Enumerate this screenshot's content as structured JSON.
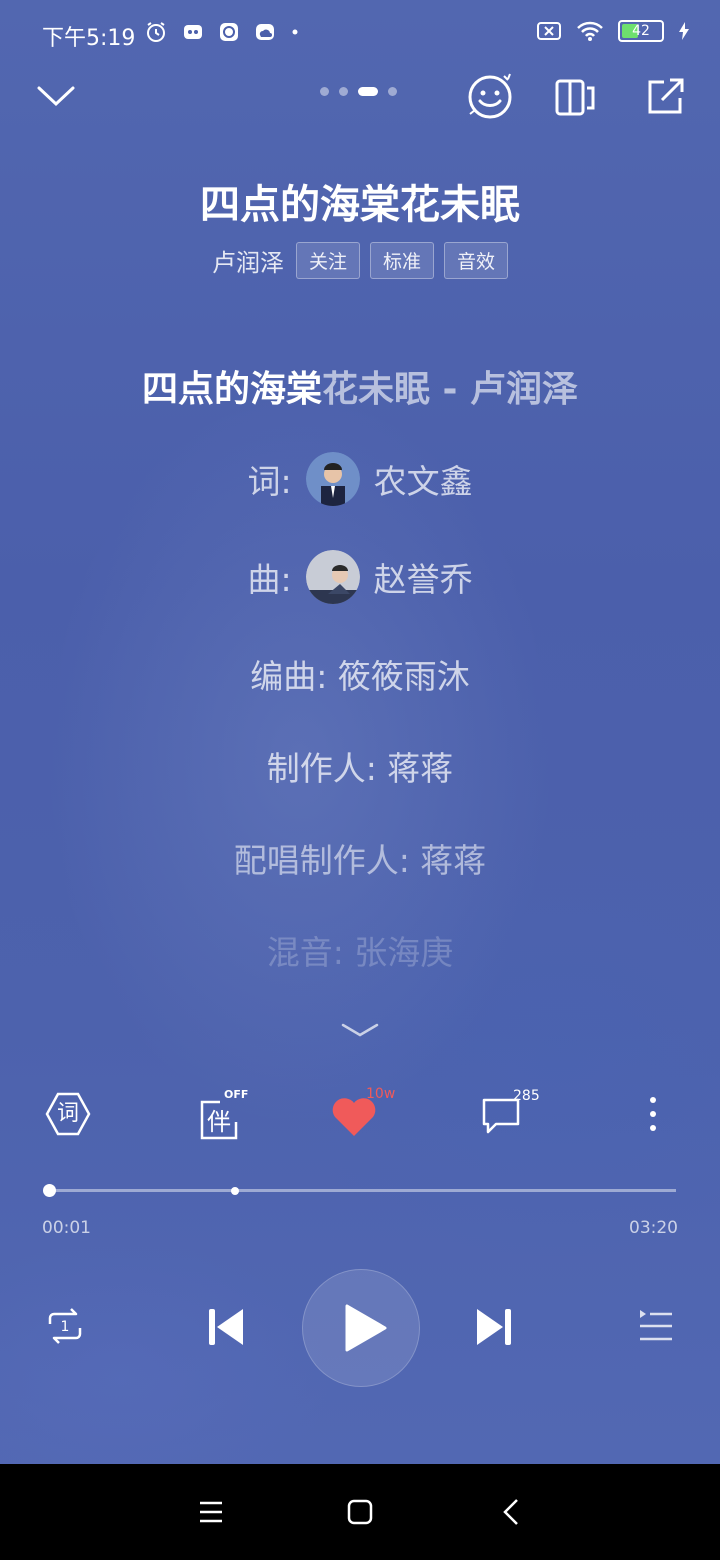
{
  "status_bar": {
    "time": "下午5:19",
    "battery_level": "42",
    "icons_left": [
      "alarm-icon",
      "app-notification-icon",
      "compass-notification-icon",
      "weather-notification-icon",
      "dot-icon"
    ],
    "icons_right": [
      "sim-off-icon",
      "wifi-icon",
      "battery-icon",
      "charging-icon"
    ]
  },
  "top_bar": {
    "page_count": 4,
    "active_page_index": 2
  },
  "song": {
    "title": "四点的海棠花未眠",
    "artist": "卢润泽",
    "tags": [
      "关注",
      "标准",
      "音效"
    ]
  },
  "lyrics": {
    "current_line_sung": "四点的海棠",
    "current_line_rest": "花未眠 - 卢润泽",
    "credits": [
      {
        "label": "词",
        "value": "农文鑫",
        "has_avatar": true
      },
      {
        "label": "曲",
        "value": "赵誉乔",
        "has_avatar": true
      },
      {
        "text": "编曲: 筱筱雨沐"
      },
      {
        "text": "制作人: 蒋蒋"
      },
      {
        "text": "配唱制作人: 蒋蒋"
      },
      {
        "text": "混音: 张海庚"
      }
    ]
  },
  "actions": {
    "lyrics_icon_label": "词",
    "accompany_label": "伴",
    "accompany_state": "OFF",
    "like_count": "10w",
    "comment_count": "285"
  },
  "player": {
    "elapsed": "00:01",
    "duration": "03:20",
    "progress_fraction": 0.005,
    "buffered_fraction": 0.3
  },
  "colors": {
    "background": "#4d62ad",
    "like_red": "#f05a5a",
    "navbar": "#000000"
  }
}
